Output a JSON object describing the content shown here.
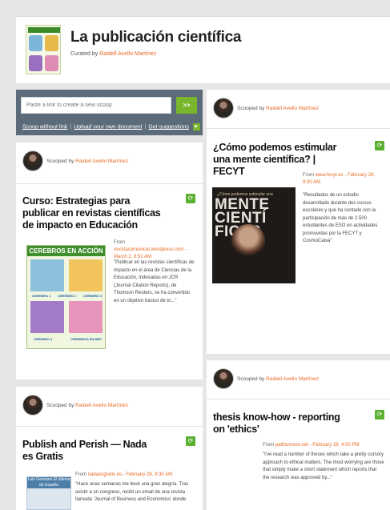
{
  "header": {
    "title": "La publicación científica",
    "curated_prefix": "Curated by",
    "curator": "Raidell Avello Martínez"
  },
  "scoop_box": {
    "placeholder": "Paste a link to create a new scoop",
    "go_label": ">>",
    "links": [
      "Scoop without link",
      "Upload your own document",
      "Get suggestions"
    ],
    "badge": "▶"
  },
  "posts": [
    {
      "scooped_by_prefix": "Scooped by",
      "author": "Raidell Avello Martínez",
      "title": "Curso: Estrategias para publicar en revistas científicas de impacto en Educación",
      "from_prefix": "From",
      "source": "revistacomunicar.wordpress.com",
      "date": "March 2, 8:51 AM",
      "excerpt": "\"Publicar en las revistas científicas de impacto en el área de Ciencias de la Educación, indexadas en JCR (Journal Citation Reports), de Thomson Reuters, se ha convertido en un objetivo básico de to...\"",
      "image": {
        "heading": "CEREBROS EN ACCIÓN",
        "labels": [
          "CEREBRO 1",
          "CEREBRO 2",
          "CEREBRO 3",
          "CEREBRO 4",
          "CEREBROS EN RED"
        ]
      }
    },
    {
      "scooped_by_prefix": "Scooped by",
      "author": "Raidell Avello Martínez",
      "title": "¿Cómo podemos estimular una mente científica? | FECYT",
      "from_prefix": "From",
      "source": "www.fecyt.es",
      "date": "February 28, 9:30 AM",
      "excerpt": "\"Resultados de un estudio desarrollado durante dos cursos escolares y que ha contado con la participación de más de 2.500 estudiantes de ESO en actividades promovidas por la FECYT y CosmoCaixa\"",
      "image": {
        "small": "¿Cómo podemos estimular una",
        "big": "MENTE CIENTÍ FICA?"
      }
    },
    {
      "scooped_by_prefix": "Scooped by",
      "author": "Raidell Avello Martínez",
      "title": "Publish and Perish — Nada es Gratis",
      "from_prefix": "From",
      "source": "nadaesgratis.es",
      "date": "February 28, 9:30 AM",
      "excerpt": "\"Hace unas semanas me llevé una gran alegría. Tras asistir a un congreso, recibí un email de una revista llamada 'Journal of Business and Economics' donde",
      "image": {
        "band": "Luis Garicano El dilema de España"
      }
    },
    {
      "scooped_by_prefix": "Scooped by",
      "author": "Raidell Avello Martínez",
      "title": "thesis know-how - reporting on 'ethics'",
      "from_prefix": "From",
      "source": "patthomson.net",
      "date": "February 28, 4:00 PM",
      "excerpt": "\"I've read a number of theses which take a pretty cursory approach to ethical matters. The most worrying are those that simply make a short statement which reports that the research was approved by...\""
    }
  ]
}
